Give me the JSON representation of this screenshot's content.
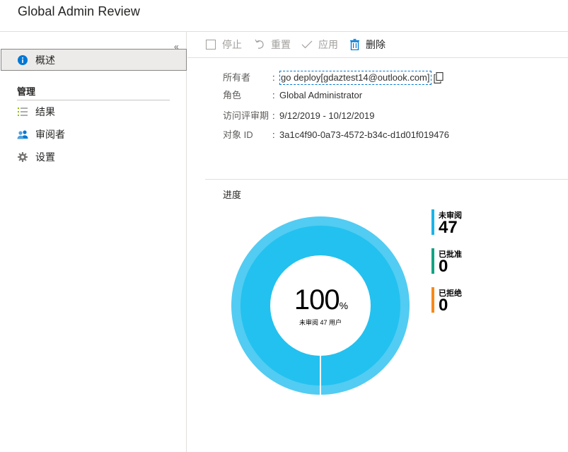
{
  "header": {
    "title": "Global Admin Review"
  },
  "nav": {
    "collapse_glyph": "«",
    "overview_label": "概述",
    "section_label": "管理",
    "items": [
      {
        "label": "结果",
        "icon": "results-list-icon"
      },
      {
        "label": "审阅者",
        "icon": "reviewers-people-icon"
      },
      {
        "label": "设置",
        "icon": "gear-icon"
      }
    ]
  },
  "toolbar": {
    "stop_label": "停止",
    "reset_label": "重置",
    "apply_label": "应用",
    "delete_label": "删除"
  },
  "details": {
    "owner_label": "所有者",
    "owner_value": "go deploy[gdaztest14@outlook.com]",
    "role_label": "角色",
    "role_value": "Global Administrator",
    "period_label": "访问评审期",
    "period_value": "9/12/2019 - 10/12/2019",
    "object_id_label": "对象 ID",
    "object_id_value": "3a1c4f90-0a73-4572-b34c-d1d01f019476",
    "colon": ":"
  },
  "progress": {
    "title": "进度",
    "percent": "100",
    "percent_sign": "%",
    "subtitle": "未审阅 47 用户",
    "legend": [
      {
        "label": "未审阅",
        "value": "47",
        "color": "#1ab4e8"
      },
      {
        "label": "已批准",
        "value": "0",
        "color": "#13a383"
      },
      {
        "label": "已拒绝",
        "value": "0",
        "color": "#f7891a"
      }
    ],
    "ring_color_outer": "#52ccf2",
    "ring_color_inner": "#23c1ef"
  }
}
